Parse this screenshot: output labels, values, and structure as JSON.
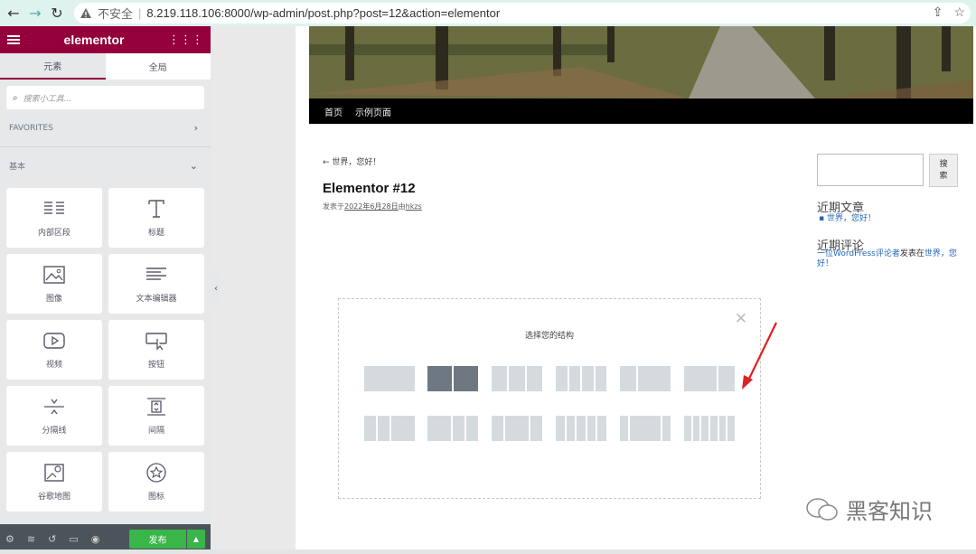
{
  "browser": {
    "security_label": "不安全",
    "separator": "|",
    "url": "8.219.118.106:8000/wp-admin/post.php?post=12&action=elementor"
  },
  "panel": {
    "logo": "elementor",
    "tabs": [
      "元素",
      "全局"
    ],
    "search_placeholder": "搜索小工具...",
    "favorites_label": "FAVORITES",
    "basic_label": "基本",
    "widgets": [
      {
        "label": "内部区段",
        "icon": "inner-section-icon"
      },
      {
        "label": "标题",
        "icon": "heading-icon"
      },
      {
        "label": "图像",
        "icon": "image-icon"
      },
      {
        "label": "文本编辑器",
        "icon": "text-editor-icon"
      },
      {
        "label": "视频",
        "icon": "video-icon"
      },
      {
        "label": "按钮",
        "icon": "button-icon"
      },
      {
        "label": "分隔线",
        "icon": "divider-icon"
      },
      {
        "label": "间隔",
        "icon": "spacer-icon"
      },
      {
        "label": "谷歌地图",
        "icon": "google-maps-icon"
      },
      {
        "label": "图标",
        "icon": "star-icon"
      }
    ],
    "publish_label": "发布",
    "accent_color": "#93003c",
    "publish_color": "#39b54a"
  },
  "preview": {
    "menu": [
      "首页",
      "示例页面"
    ],
    "back_link": "← 世界，您好！",
    "post_title": "Elementor #12",
    "meta_prefix": "发表于",
    "meta_date": "2022年6月28日",
    "meta_by": "由",
    "meta_author": "hkzs",
    "search_button": "搜\n索",
    "recent_posts_heading": "近期文章",
    "recent_posts": [
      "世界，您好！"
    ],
    "recent_comments_heading": "近期评论",
    "comment_author": "一位WordPress评论者",
    "comment_on": "发表在",
    "comment_post": "世界，您好！",
    "structure_title": "选择您的结构"
  },
  "watermark": "黑客知识"
}
